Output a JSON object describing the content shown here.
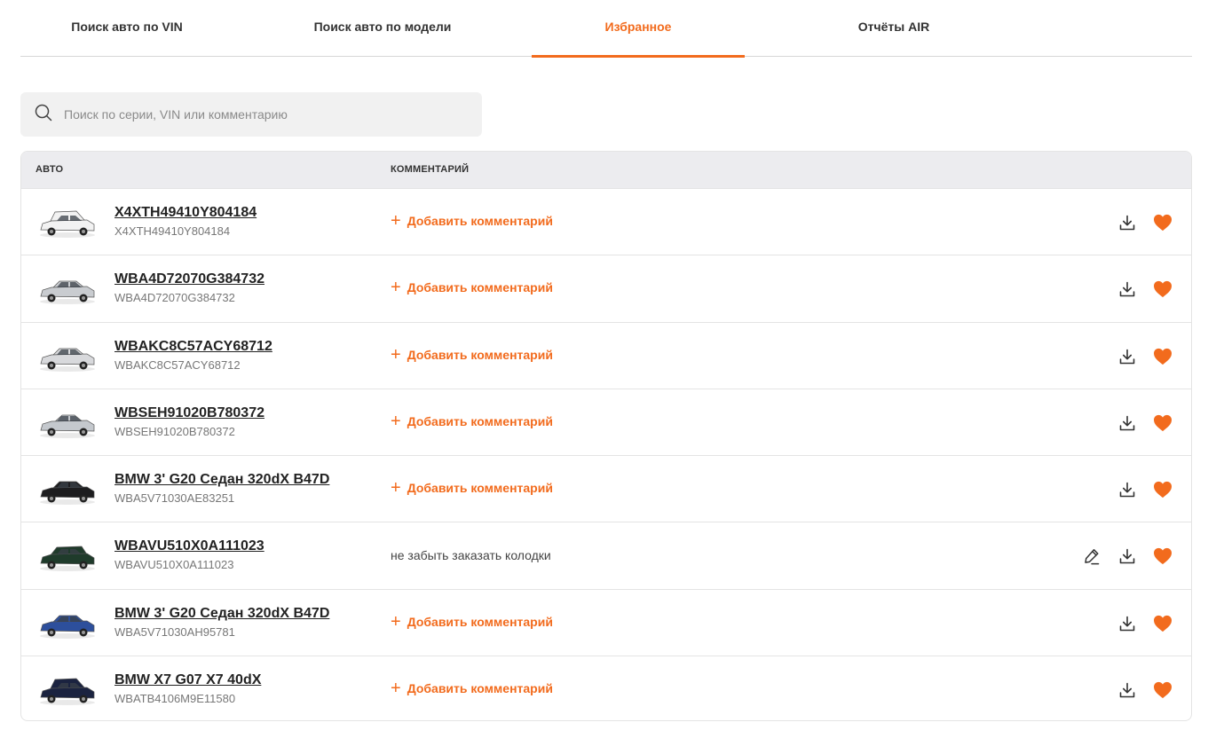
{
  "tabs": [
    {
      "label": "Поиск авто по VIN",
      "active": false
    },
    {
      "label": "Поиск авто по модели",
      "active": false
    },
    {
      "label": "Избранное",
      "active": true
    },
    {
      "label": "Отчёты AIR",
      "active": false
    }
  ],
  "search": {
    "placeholder": "Поиск по серии, VIN или комментарию",
    "value": ""
  },
  "table": {
    "headers": {
      "car": "АВТО",
      "comment": "КОММЕНТАРИЙ"
    },
    "add_comment_label": "Добавить комментарий",
    "rows": [
      {
        "title": "X4XTH49410Y804184",
        "vin": "X4XTH49410Y804184",
        "comment": "",
        "car_color": "#f2f2f2",
        "car_shape": "suv",
        "favorite": true
      },
      {
        "title": "WBA4D72070G384732",
        "vin": "WBA4D72070G384732",
        "comment": "",
        "car_color": "#c9ccd0",
        "car_shape": "sedan",
        "favorite": true
      },
      {
        "title": "WBAKC8C57ACY68712",
        "vin": "WBAKC8C57ACY68712",
        "comment": "",
        "car_color": "#d8d9dc",
        "car_shape": "sedan",
        "favorite": true
      },
      {
        "title": "WBSEH91020B780372",
        "vin": "WBSEH91020B780372",
        "comment": "",
        "car_color": "#c4c8cd",
        "car_shape": "coupe",
        "favorite": true
      },
      {
        "title": "BMW 3' G20 Седан 320dX B47D",
        "vin": "WBA5V71030AE83251",
        "comment": "",
        "car_color": "#1d1d1f",
        "car_shape": "sedan",
        "favorite": true
      },
      {
        "title": "WBAVU510X0A111023",
        "vin": "WBAVU510X0A111023",
        "comment": "не забыть заказать колодки",
        "car_color": "#1f3b2b",
        "car_shape": "wagon",
        "favorite": true
      },
      {
        "title": "BMW 3' G20 Седан 320dX B47D",
        "vin": "WBA5V71030AH95781",
        "comment": "",
        "car_color": "#2d4f9c",
        "car_shape": "sedan",
        "favorite": true
      },
      {
        "title": "BMW X7 G07 X7 40dX",
        "vin": "WBATB4106M9E11580",
        "comment": "",
        "car_color": "#1b2340",
        "car_shape": "suv",
        "favorite": true
      }
    ]
  },
  "icons": {
    "search": "search-icon",
    "download": "download-icon",
    "favorite": "heart-icon",
    "edit": "pencil-icon",
    "add": "plus-icon"
  },
  "colors": {
    "accent": "#f26b1d",
    "header_bg": "#ececef",
    "search_bg": "#f1f1f1"
  }
}
